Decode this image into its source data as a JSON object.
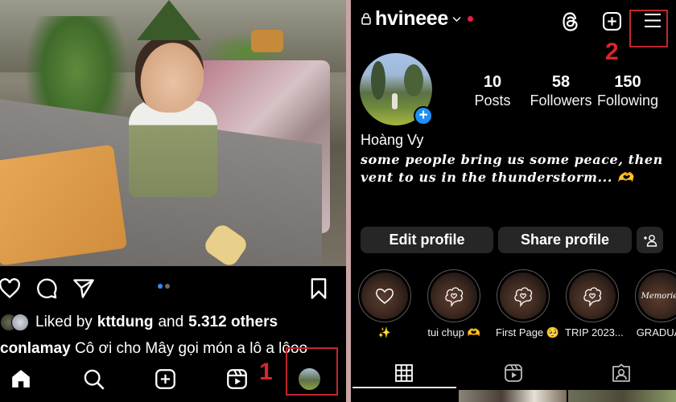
{
  "feed": {
    "carousel": {
      "current": 1,
      "total": 2,
      "active_color": "#2f8ef0",
      "inactive_color": "#6b6b6b"
    },
    "actions": {
      "like_icon": "heart-icon",
      "comment_icon": "comment-icon",
      "share_icon": "paper-plane-icon",
      "save_icon": "bookmark-icon"
    },
    "likes": {
      "prefix": "Liked by",
      "user": "kttdung",
      "joiner": "and",
      "others": "5.312 others"
    },
    "caption": {
      "username": "conlamay",
      "text": "Cô ơi cho Mây gọi món a lô a lôoo"
    },
    "tabbar": [
      {
        "name": "home",
        "icon": "home-icon"
      },
      {
        "name": "search",
        "icon": "search-icon"
      },
      {
        "name": "create",
        "icon": "plus-square-icon"
      },
      {
        "name": "reels",
        "icon": "reels-icon"
      },
      {
        "name": "profile",
        "icon": "profile-avatar"
      }
    ]
  },
  "profile": {
    "username": "hvineee",
    "header_icons": [
      "threads-icon",
      "plus-square-icon",
      "menu-icon"
    ],
    "stats": [
      {
        "value": "10",
        "label": "Posts"
      },
      {
        "value": "58",
        "label": "Followers"
      },
      {
        "value": "150",
        "label": "Following"
      }
    ],
    "full_name": "Hoàng Vy",
    "bio": "some people bring us some peace, then vent to us in the thunderstorm... 🫶",
    "buttons": {
      "edit": "Edit profile",
      "share": "Share profile"
    },
    "highlights": [
      {
        "label": "✨"
      },
      {
        "label": "tui chụp 🫶"
      },
      {
        "label": "First Page 🥺"
      },
      {
        "label": "TRIP 2023..."
      },
      {
        "label": "GRADUAT"
      }
    ],
    "highlight_cover_text": "Memories",
    "tabs": [
      "grid-icon",
      "reels-icon",
      "tagged-icon"
    ],
    "active_tab": 0
  },
  "annotations": {
    "step1": "1",
    "step2": "2",
    "color": "#c0272d"
  }
}
